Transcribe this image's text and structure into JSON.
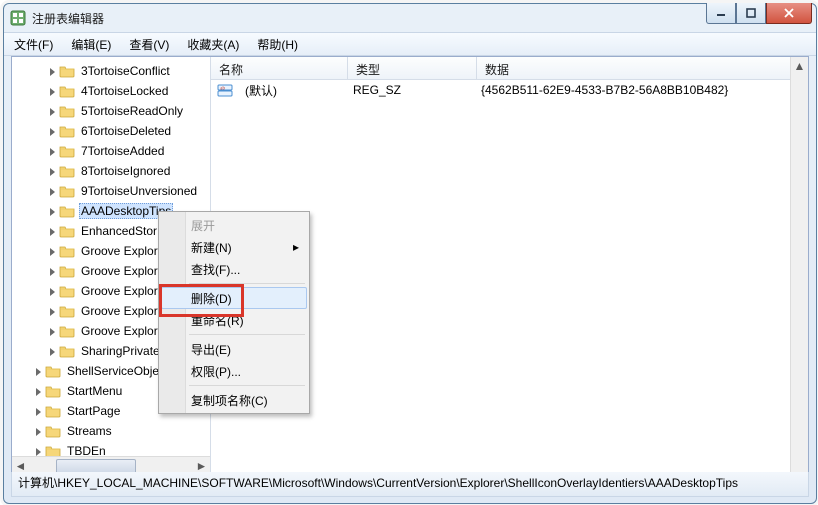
{
  "window": {
    "title": "注册表编辑器"
  },
  "menu": {
    "file": "文件(F)",
    "edit": "编辑(E)",
    "view": "查看(V)",
    "fav": "收藏夹(A)",
    "help": "帮助(H)"
  },
  "tree": {
    "items": [
      {
        "label": "3TortoiseConflict",
        "depth": 2,
        "expandable": true
      },
      {
        "label": "4TortoiseLocked",
        "depth": 2,
        "expandable": true
      },
      {
        "label": "5TortoiseReadOnly",
        "depth": 2,
        "expandable": true
      },
      {
        "label": "6TortoiseDeleted",
        "depth": 2,
        "expandable": true
      },
      {
        "label": "7TortoiseAdded",
        "depth": 2,
        "expandable": true
      },
      {
        "label": "8TortoiseIgnored",
        "depth": 2,
        "expandable": true
      },
      {
        "label": "9TortoiseUnversioned",
        "depth": 2,
        "expandable": true
      },
      {
        "label": "AAADesktopTips",
        "depth": 2,
        "expandable": true,
        "selected": true
      },
      {
        "label": "EnhancedStor",
        "depth": 2,
        "expandable": true
      },
      {
        "label": "Groove Explor",
        "depth": 2,
        "expandable": true
      },
      {
        "label": "Groove Explor",
        "depth": 2,
        "expandable": true
      },
      {
        "label": "Groove Explor",
        "depth": 2,
        "expandable": true
      },
      {
        "label": "Groove Explor",
        "depth": 2,
        "expandable": true
      },
      {
        "label": "Groove Explor",
        "depth": 2,
        "expandable": true
      },
      {
        "label": "SharingPrivate",
        "depth": 2,
        "expandable": true
      },
      {
        "label": "ShellServiceObjec",
        "depth": 1,
        "expandable": true
      },
      {
        "label": "StartMenu",
        "depth": 1,
        "expandable": true
      },
      {
        "label": "StartPage",
        "depth": 1,
        "expandable": true
      },
      {
        "label": "Streams",
        "depth": 1,
        "expandable": true
      },
      {
        "label": "TBDEn",
        "depth": 1,
        "expandable": true
      }
    ]
  },
  "list": {
    "headers": {
      "name": "名称",
      "type": "类型",
      "data": "数据"
    },
    "cols": {
      "name": 120,
      "type": 112,
      "data": 360
    },
    "rows": [
      {
        "name": "(默认)",
        "type": "REG_SZ",
        "data": "{4562B511-62E9-4533-B7B2-56A8BB10B482}"
      }
    ]
  },
  "context": {
    "expand": "展开",
    "new": "新建(N)",
    "find": "查找(F)...",
    "delete": "删除(D)",
    "rename": "重命名(R)",
    "export": "导出(E)",
    "perm": "权限(P)...",
    "copyname": "复制项名称(C)"
  },
  "status": "计算机\\HKEY_LOCAL_MACHINE\\SOFTWARE\\Microsoft\\Windows\\CurrentVersion\\Explorer\\ShellIconOverlayIdentiers\\AAADesktopTips"
}
